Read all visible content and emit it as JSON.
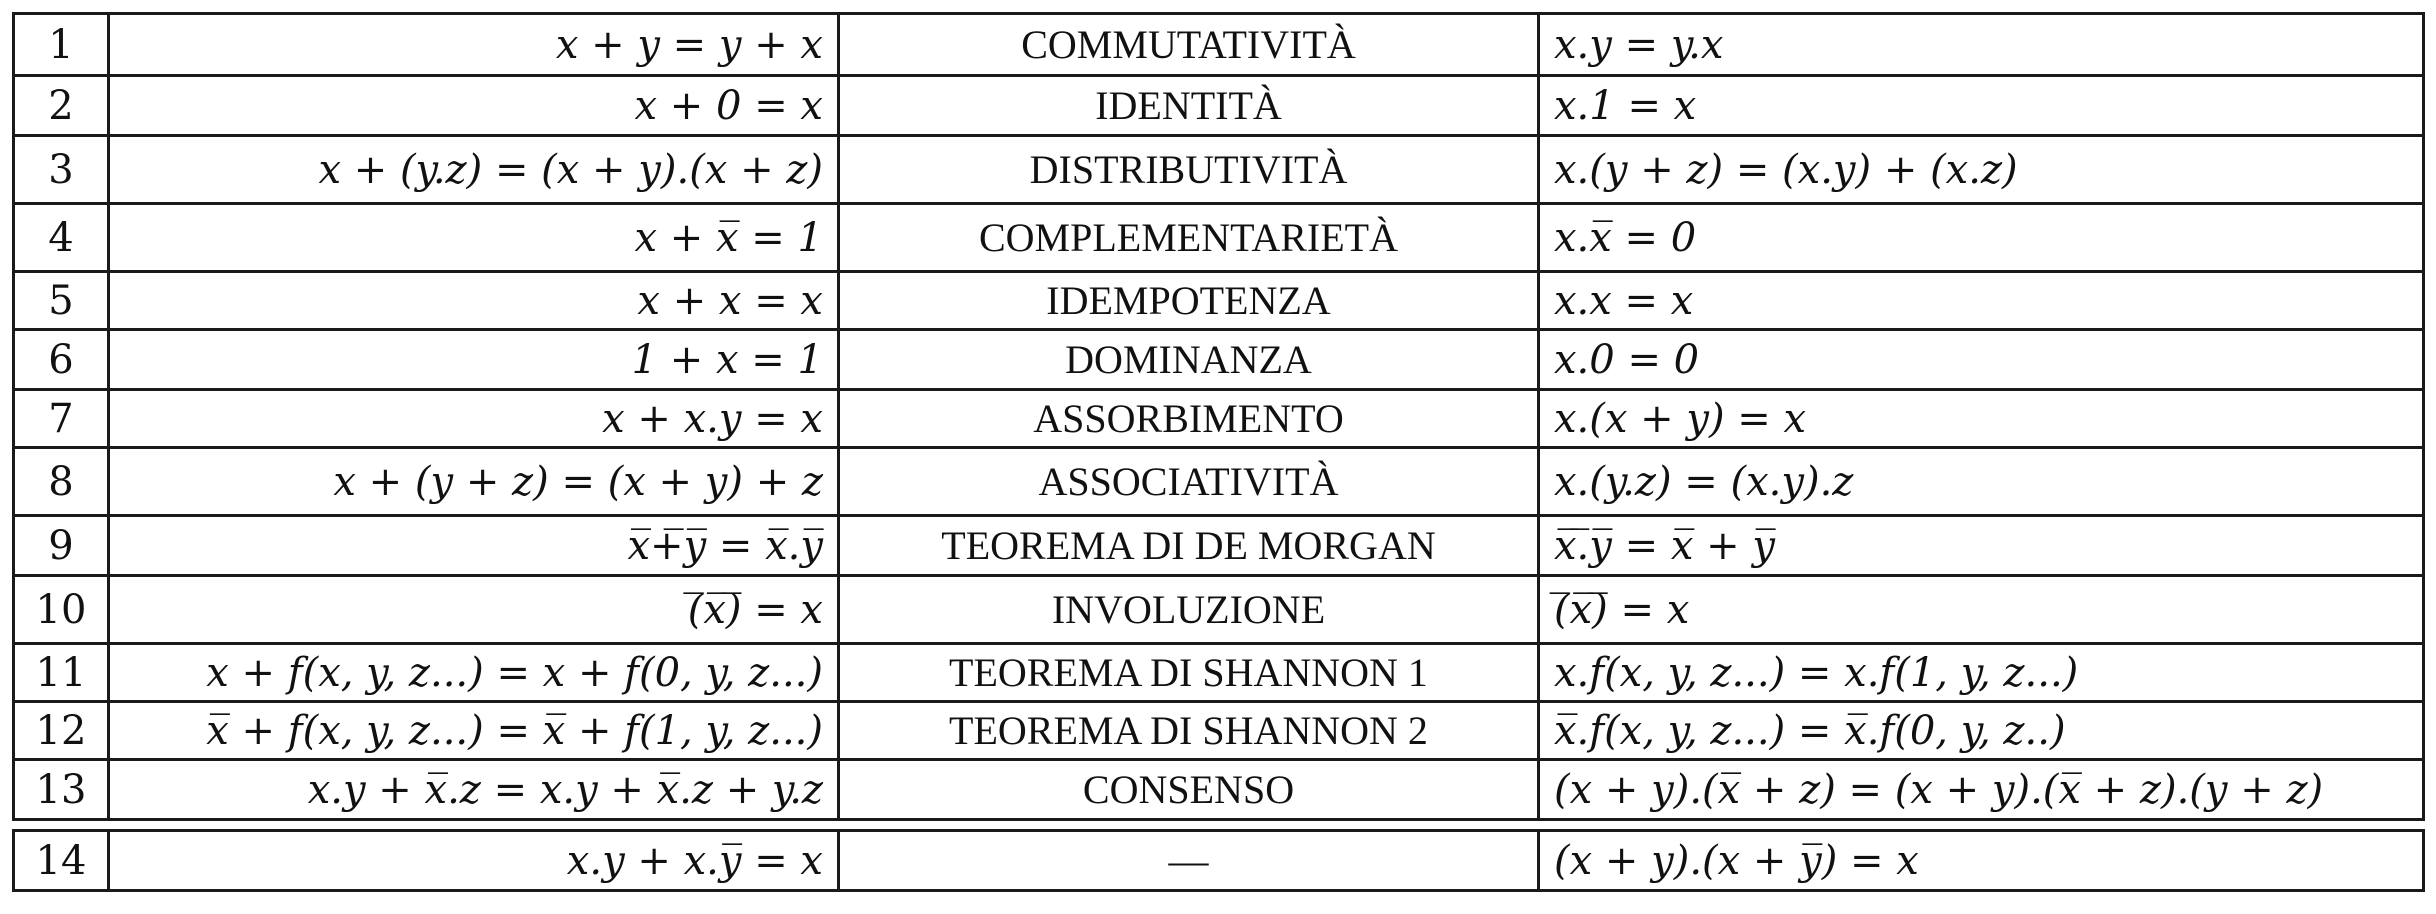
{
  "rows": [
    {
      "num": "1",
      "left": "x + y = y + x",
      "name": "COMMUTATIVITÀ",
      "right": "x.y = y.x"
    },
    {
      "num": "2",
      "left": "x + 0 = x",
      "name": "IDENTITÀ",
      "right": "x.1 = x"
    },
    {
      "num": "3",
      "left": "x + (y.z) = (x + y).(x + z)",
      "name": "DISTRIBUTIVITÀ",
      "right": "x.(y + z) = (x.y) + (x.z)"
    },
    {
      "num": "4",
      "left": "x + x̅ = 1",
      "name": "COMPLEMENTARIETÀ",
      "right": "x.x̅ = 0"
    },
    {
      "num": "5",
      "left": "x + x = x",
      "name": "IDEMPOTENZA",
      "right": "x.x = x"
    },
    {
      "num": "6",
      "left": "1 + x = 1",
      "name": "DOMINANZA",
      "right": "x.0 = 0"
    },
    {
      "num": "7",
      "left": "x + x.y = x",
      "name": "ASSORBIMENTO",
      "right": "x.(x + y) = x"
    },
    {
      "num": "8",
      "left": "x + (y + z) = (x + y) + z",
      "name": "ASSOCIATIVITÀ",
      "right": "x.(y.z) = (x.y).z"
    },
    {
      "num": "9",
      "left": "x̅+̅y̅ = x̅.y̅",
      "name": "TEOREMA DI DE MORGAN",
      "right": "x̅.̅y̅ = x̅ + y̅"
    },
    {
      "num": "10",
      "left": "(̅x̅)̅ = x",
      "name": "INVOLUZIONE",
      "right": "(̅x̅)̅ = x"
    },
    {
      "num": "11",
      "left": "x + f(x, y, z...) = x + f(0, y, z...)",
      "name": "TEOREMA DI SHANNON 1",
      "right": "x.f(x, y, z...) = x.f(1, y, z...)"
    },
    {
      "num": "12",
      "left": "x̅ + f(x, y, z...) = x̅ + f(1, y, z...)",
      "name": "TEOREMA DI SHANNON 2",
      "right": "x̅.f(x, y, z...) = x̅.f(0, y, z..)"
    },
    {
      "num": "13",
      "left": "x.y + x̅.z = x.y + x̅.z + y.z",
      "name": "CONSENSO",
      "right": "(x + y).(x̅ + z) = (x + y).(x̅ + z).(y + z)"
    },
    {
      "num": "14",
      "left": "x.y + x.y̅ = x",
      "name": "—",
      "right": "(x + y).(x + y̅) = x"
    }
  ]
}
